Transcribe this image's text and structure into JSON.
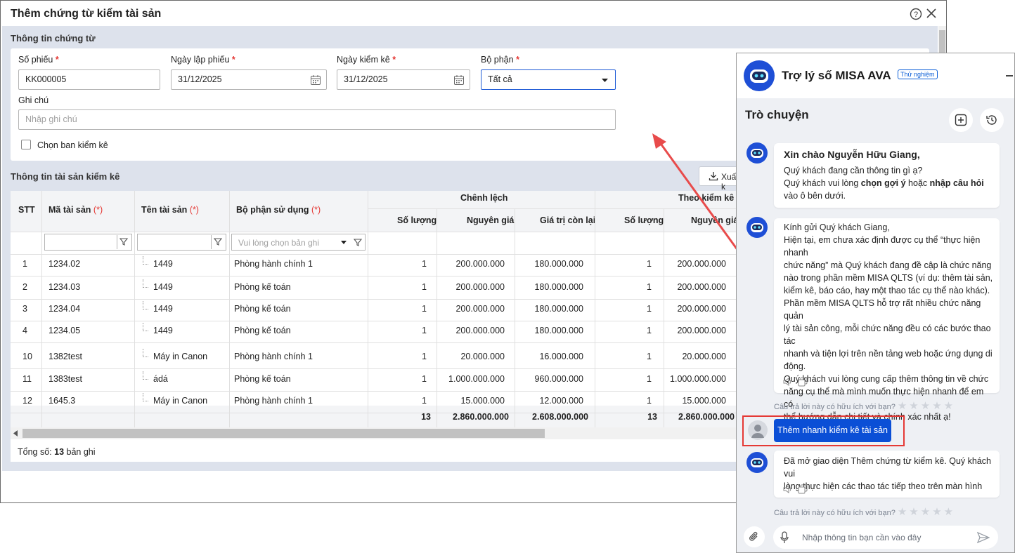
{
  "dialog": {
    "title": "Thêm chứng từ kiểm tài sản",
    "section_info": "Thông tin chứng từ",
    "section_assets": "Thông tin tài sản kiểm kê",
    "export_label": "Xuất k",
    "fields": {
      "so_phieu": {
        "label": "Số phiếu",
        "required": "*",
        "value": "KK000005"
      },
      "ngay_lap": {
        "label": "Ngày lập phiếu",
        "required": "*",
        "value": "31/12/2025"
      },
      "ngay_kiem_ke": {
        "label": "Ngày kiểm kê",
        "required": "*",
        "value": "31/12/2025"
      },
      "bo_phan": {
        "label": "Bộ phận",
        "required": "*",
        "value": "Tất cả"
      },
      "ghi_chu": {
        "label": "Ghi chú",
        "placeholder": "Nhập ghi chú"
      },
      "chon_ban": {
        "label": "Chọn ban kiểm kê",
        "checked": false
      }
    }
  },
  "table": {
    "headers": {
      "stt": "STT",
      "ma": "Mã tài sản",
      "ten": "Tên tài sản",
      "bo_phan": "Bộ phận sử dụng",
      "req_mark": "(*)",
      "chenh_lech": "Chênh lệch",
      "theo_kiem_ke": "Theo kiểm kê",
      "so_luong": "Số lượng",
      "nguyen_gia": "Nguyên giá",
      "gia_tri_con_lai": "Giá trị còn lại",
      "nguyen_gia_cut": "Nguyên giá"
    },
    "filter_placeholder": "Vui lòng chọn bản ghi",
    "rows": [
      {
        "stt": "1",
        "ma": "1234.02",
        "ten": "1449",
        "bp": "Phòng hành chính 1",
        "sl": "1",
        "ng": "200.000.000",
        "gt": "180.000.000",
        "sl2": "1",
        "ng2": "200.000.000"
      },
      {
        "stt": "2",
        "ma": "1234.03",
        "ten": "1449",
        "bp": "Phòng kế toán",
        "sl": "1",
        "ng": "200.000.000",
        "gt": "180.000.000",
        "sl2": "1",
        "ng2": "200.000.000"
      },
      {
        "stt": "3",
        "ma": "1234.04",
        "ten": "1449",
        "bp": "Phòng kế toán",
        "sl": "1",
        "ng": "200.000.000",
        "gt": "180.000.000",
        "sl2": "1",
        "ng2": "200.000.000"
      },
      {
        "stt": "4",
        "ma": "1234.05",
        "ten": "1449",
        "bp": "Phòng kế toán",
        "sl": "1",
        "ng": "200.000.000",
        "gt": "180.000.000",
        "sl2": "1",
        "ng2": "200.000.000"
      },
      {
        "stt": "10",
        "ma": "1382test",
        "ten": "Máy in Canon",
        "bp": "Phòng hành chính 1",
        "sl": "1",
        "ng": "20.000.000",
        "gt": "16.000.000",
        "sl2": "1",
        "ng2": "20.000.000"
      },
      {
        "stt": "11",
        "ma": "1383test",
        "ten": "ádá",
        "bp": "Phòng kế toán",
        "sl": "1",
        "ng": "1.000.000.000",
        "gt": "960.000.000",
        "sl2": "1",
        "ng2": "1.000.000.000"
      },
      {
        "stt": "12",
        "ma": "1645.3",
        "ten": "Máy in Canon",
        "bp": "Phòng hành chính 1",
        "sl": "1",
        "ng": "15.000.000",
        "gt": "12.000.000",
        "sl2": "1",
        "ng2": "15.000.000"
      }
    ],
    "totals": {
      "sl": "13",
      "ng": "2.860.000.000",
      "gt": "2.608.000.000",
      "sl2": "13",
      "ng2": "2.860.000.000"
    },
    "footer_prefix": "Tổng số:",
    "footer_count": "13",
    "footer_suffix": "bản ghi"
  },
  "chat": {
    "title": "Trợ lý số MISA AVA",
    "badge": "Thử nghiệm",
    "section": "Trò chuyện",
    "greeting_title": "Xin chào Nguyễn Hữu Giang,",
    "greeting_line1": "Quý khách đang cần thông tin gì ạ?",
    "greeting_pre": "Quý khách vui lòng",
    "greeting_b1": "chọn gợi ý",
    "greeting_mid": "hoặc",
    "greeting_b2": "nhập câu hỏi",
    "greeting_post": "vào ô bên dưới.",
    "reply1_lines": [
      "Kính gửi Quý khách Giang,",
      "Hiện tại, em chưa xác định được cụ thể “thực hiện nhanh",
      "chức năng” mà Quý khách đang đề cập là chức năng",
      "nào trong phần mềm MISA QLTS (ví dụ: thêm tài sản,",
      "kiểm kê, báo cáo, hay một thao tác cụ thể nào khác).",
      "Phần mềm MISA QLTS hỗ trợ rất nhiều chức năng quản",
      "lý tài sản công, mỗi chức năng đều có các bước thao tác",
      "nhanh và tiện lợi trên nền tảng web hoặc ứng dụng di",
      "động.",
      "Quý khách vui lòng cung cấp thêm thông tin về chức",
      "năng cụ thể mà mình muốn thực hiện nhanh để em có",
      "thể hướng dẫn chi tiết và chính xác nhất ạ!"
    ],
    "rating_prompt": "Câu trả lời này có hữu ích với bạn?",
    "user_message": "Thêm nhanh kiểm kê tài sản",
    "reply2_lines": [
      "Đã mở giao diện Thêm chứng từ kiểm kê. Quý khách vui",
      "lòng thực hiện các thao tác tiếp theo trên màn hình"
    ],
    "input_placeholder": "Nhập thông tin bạn cần vào đây"
  },
  "colors": {
    "accent": "#0b5ed7",
    "highlight": "#e53935",
    "arrow": "#e84b4b"
  }
}
